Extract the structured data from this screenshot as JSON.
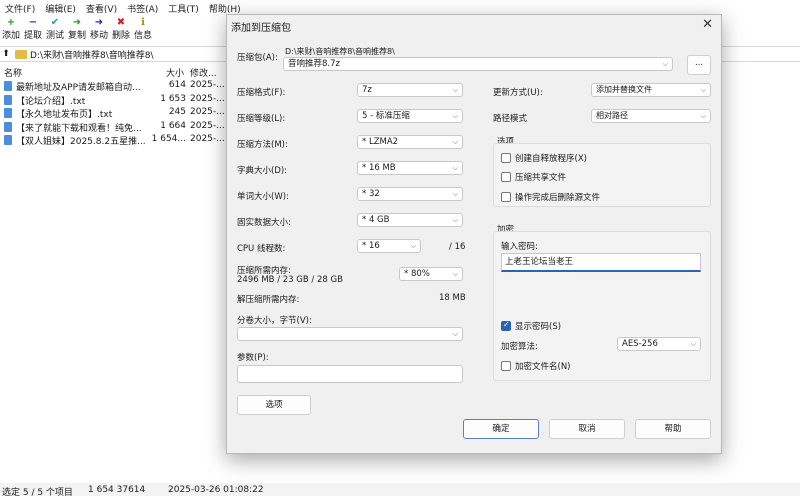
{
  "menu": [
    "文件(F)",
    "编辑(E)",
    "查看(V)",
    "书签(A)",
    "工具(T)",
    "帮助(H)"
  ],
  "toolbar": [
    {
      "label": "添加",
      "icon": "+",
      "color": "#2a9a2a"
    },
    {
      "label": "提取",
      "icon": "−",
      "color": "#2a2ab0"
    },
    {
      "label": "测试",
      "icon": "✔",
      "color": "#1aa0b0"
    },
    {
      "label": "复制",
      "icon": "➜",
      "color": "#2a9a2a"
    },
    {
      "label": "移动",
      "icon": "➜",
      "color": "#2a2ab0"
    },
    {
      "label": "删除",
      "icon": "✖",
      "color": "#d02020"
    },
    {
      "label": "信息",
      "icon": "ℹ",
      "color": "#b08a00"
    }
  ],
  "address": "D:\\来财\\音响推荐8\\音响推荐8\\",
  "file_list": {
    "headers": {
      "name": "名称",
      "size": "大小",
      "modified": "修改..."
    },
    "rows": [
      {
        "name": "最新地址及APP请发邮箱自动...",
        "size": "614",
        "date": "2025-..."
      },
      {
        "name": "【论坛介绍】.txt",
        "size": "1 653",
        "date": "2025-..."
      },
      {
        "name": "【永久地址发布页】.txt",
        "size": "245",
        "date": "2025-..."
      },
      {
        "name": "【来了就能下载和观看！纯免...",
        "size": "1 664",
        "date": "2025-..."
      },
      {
        "name": "【双人姐妹】2025.8.2五星推...",
        "size": "1 654...",
        "date": "2025-..."
      }
    ]
  },
  "status": {
    "selection": "选定 5 / 5 个项目",
    "size": "1 654 37614",
    "date": "2025-03-26 01:08:22"
  },
  "dialog": {
    "title": "添加到压缩包",
    "archive_label": "压缩包(A):",
    "archive_dir": "D:\\来财\\音响推荐8\\音响推荐8\\",
    "archive_name": "音响推荐8.7z",
    "browse": "...",
    "left": {
      "format_label": "压缩格式(F):",
      "format_value": "7z",
      "level_label": "压缩等级(L):",
      "level_value": "5 - 标准压缩",
      "method_label": "压缩方法(M):",
      "method_value": "*  LZMA2",
      "dict_label": "字典大小(D):",
      "dict_value": "*  16 MB",
      "word_label": "单词大小(W):",
      "word_value": "*  32",
      "solid_label": "固实数据大小:",
      "solid_value": "*  4 GB",
      "cpu_label": "CPU 线程数:",
      "cpu_value": "*  16",
      "cpu_total": "/ 16",
      "mem_comp_label": "压缩所需内存:",
      "mem_comp_value": "2496 MB / 23 GB / 28 GB",
      "mem_percent": "* 80%",
      "mem_decomp_label": "解压缩所需内存:",
      "mem_decomp_value": "18 MB",
      "split_label": "分卷大小，字节(V):",
      "split_value": "",
      "params_label": "参数(P):",
      "params_value": "",
      "options_button": "选项"
    },
    "right": {
      "update_label": "更新方式(U):",
      "update_value": "添加并替换文件",
      "path_label": "路径模式",
      "path_value": "相对路径",
      "options_group": "选项",
      "opt_sfx": "创建自释放程序(X)",
      "opt_shared": "压缩共享文件",
      "opt_delete": "操作完成后删除源文件",
      "enc_group": "加密",
      "pwd_label": "输入密码:",
      "pwd_value": "上老王论坛当老王",
      "show_pwd": "显示密码(S)",
      "enc_method_label": "加密算法:",
      "enc_method_value": "AES-256",
      "enc_names": "加密文件名(N)"
    },
    "buttons": {
      "ok": "确定",
      "cancel": "取消",
      "help": "帮助"
    }
  }
}
